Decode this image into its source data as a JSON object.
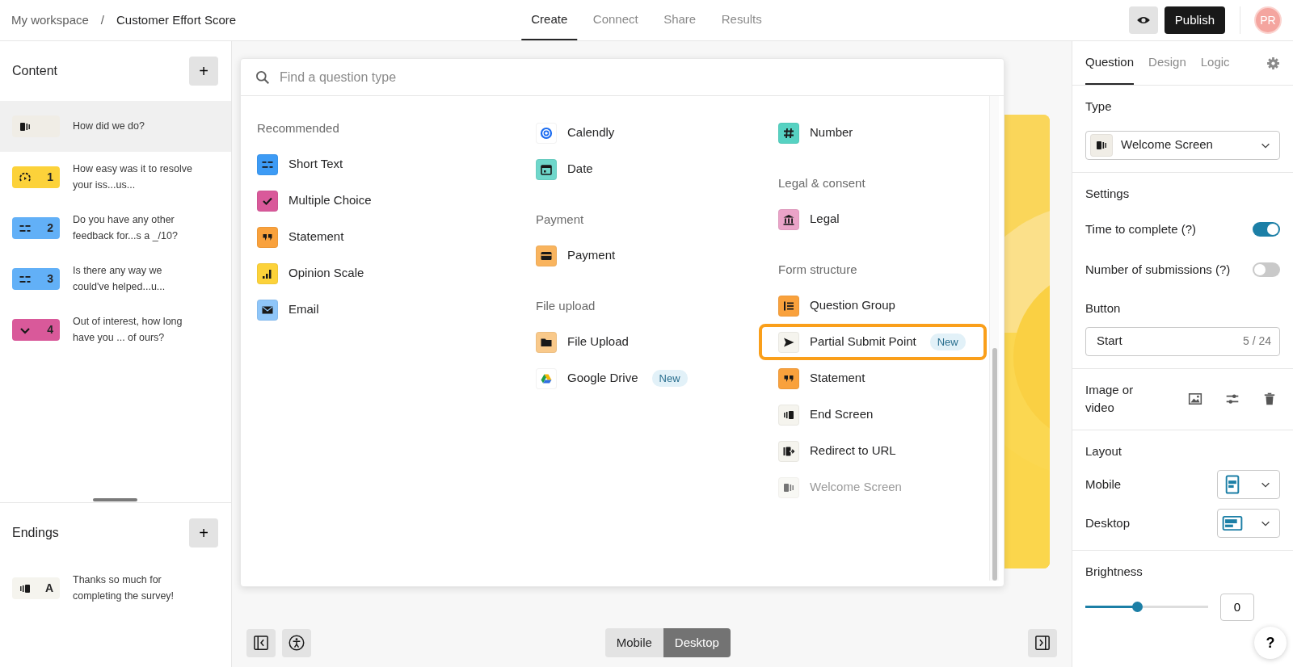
{
  "topbar": {
    "breadcrumb": [
      "My workspace",
      "Customer Effort Score"
    ],
    "separator": "/",
    "tabs": [
      {
        "label": "Create",
        "selected": true
      },
      {
        "label": "Connect",
        "selected": false
      },
      {
        "label": "Share",
        "selected": false
      },
      {
        "label": "Results",
        "selected": false
      }
    ],
    "publish": "Publish",
    "avatar": "PR"
  },
  "content": {
    "title": "Content",
    "add": "+",
    "items": [
      {
        "kind": "welcome",
        "color": "#f0ede6",
        "text": "How did we do?",
        "selected": true
      },
      {
        "kind": "gauge",
        "color": "#fcd23a",
        "number": "1",
        "text": "How easy was it to resolve your iss...us...",
        "selected": false
      },
      {
        "kind": "short-text",
        "color": "#62b0f7",
        "number": "2",
        "text": "Do you have any other feedback for...s a _/10?",
        "selected": false
      },
      {
        "kind": "short-text",
        "color": "#62b0f7",
        "number": "3",
        "text": "Is there any way we could've helped...u...",
        "selected": false
      },
      {
        "kind": "chevron",
        "color": "#d9599a",
        "number": "4",
        "text": "Out of interest, how long have you ... of ours?",
        "selected": false
      }
    ]
  },
  "endings": {
    "title": "Endings",
    "add": "+",
    "items": [
      {
        "kind": "end",
        "color": "#f5f4ee",
        "number": "A",
        "text": "Thanks so much for completing the survey!",
        "selected": false
      }
    ]
  },
  "question_menu": {
    "placeholder": "Find a question type",
    "columns": [
      {
        "groups": [
          {
            "title": "Recommended",
            "items": [
              {
                "label": "Short Text",
                "kind": "short-text",
                "color": "#3d9bf5",
                "highlighted": false,
                "disabled": false
              },
              {
                "label": "Multiple Choice",
                "kind": "check",
                "color": "#d9599a",
                "highlighted": false,
                "disabled": false
              },
              {
                "label": "Statement",
                "kind": "quote",
                "color": "#f9a13c",
                "highlighted": false,
                "disabled": false
              },
              {
                "label": "Opinion Scale",
                "kind": "bars",
                "color": "#fcd23a",
                "highlighted": false,
                "disabled": false
              },
              {
                "label": "Email",
                "kind": "mail",
                "color": "#8fc6f9",
                "highlighted": false,
                "disabled": false
              }
            ]
          }
        ]
      },
      {
        "groups": [
          {
            "items": [
              {
                "label": "Calendly",
                "kind": "calendly",
                "color": "#ffffff",
                "highlighted": false,
                "disabled": false
              },
              {
                "label": "Date",
                "kind": "calendar",
                "color": "#6fd7cb",
                "highlighted": false,
                "disabled": false
              }
            ]
          },
          {
            "title": "Payment",
            "items": [
              {
                "label": "Payment",
                "kind": "card",
                "color": "#f9b45e",
                "highlighted": false,
                "disabled": false
              }
            ]
          },
          {
            "title": "File upload",
            "items": [
              {
                "label": "File Upload",
                "kind": "folder",
                "color": "#f9c98a",
                "highlighted": false,
                "disabled": false
              },
              {
                "label": "Google Drive",
                "kind": "drive",
                "color": "#ffffff",
                "badge": "New",
                "highlighted": false,
                "disabled": false
              }
            ]
          }
        ]
      },
      {
        "groups": [
          {
            "items": [
              {
                "label": "Number",
                "kind": "hash",
                "color": "#56d2c2",
                "highlighted": false,
                "disabled": false
              }
            ]
          },
          {
            "title": "Legal & consent",
            "items": [
              {
                "label": "Legal",
                "kind": "bank",
                "color": "#eaa3c8",
                "highlighted": false,
                "disabled": false
              }
            ]
          },
          {
            "title": "Form structure",
            "items": [
              {
                "label": "Question Group",
                "kind": "group",
                "color": "#f9a13c",
                "highlighted": false,
                "disabled": false
              },
              {
                "label": "Partial Submit Point",
                "kind": "send",
                "color": "#f5f4ee",
                "badge": "New",
                "highlighted": true,
                "disabled": false
              },
              {
                "label": "Statement",
                "kind": "quote",
                "color": "#f9a13c",
                "highlighted": false,
                "disabled": false
              },
              {
                "label": "End Screen",
                "kind": "end",
                "color": "#f5f4ee",
                "highlighted": false,
                "disabled": false
              },
              {
                "label": "Redirect to URL",
                "kind": "redirect",
                "color": "#f5f4ee",
                "highlighted": false,
                "disabled": false
              },
              {
                "label": "Welcome Screen",
                "kind": "welcome",
                "color": "#f5f4ee",
                "highlighted": false,
                "disabled": true
              }
            ]
          }
        ]
      }
    ]
  },
  "view_toggle": [
    {
      "label": "Mobile",
      "selected": false
    },
    {
      "label": "Desktop",
      "selected": true
    }
  ],
  "panel": {
    "tabs": [
      {
        "label": "Question",
        "selected": true
      },
      {
        "label": "Design",
        "selected": false
      },
      {
        "label": "Logic",
        "selected": false
      }
    ],
    "type": {
      "title": "Type",
      "value": "Welcome Screen",
      "kind": "welcome"
    },
    "settings": {
      "title": "Settings",
      "toggles": [
        {
          "label": "Time to complete (?)",
          "on": true
        },
        {
          "label": "Number of submissions (?)",
          "on": false
        }
      ]
    },
    "button": {
      "label": "Button",
      "value": "Start",
      "counter": "5 / 24"
    },
    "media": {
      "label": "Image or video"
    },
    "layout": {
      "title": "Layout",
      "rows": [
        {
          "label": "Mobile",
          "kind": "layout-mobile"
        },
        {
          "label": "Desktop",
          "kind": "layout-desktop"
        }
      ]
    },
    "brightness": {
      "title": "Brightness",
      "level": 0.42,
      "value": "0"
    }
  },
  "help": "?"
}
